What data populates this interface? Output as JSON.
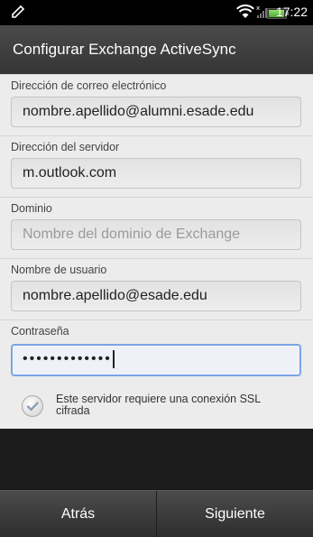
{
  "status_bar": {
    "time": "17:22"
  },
  "header": {
    "title": "Configurar Exchange ActiveSync"
  },
  "form": {
    "email": {
      "label": "Dirección de correo electrónico",
      "value": "nombre.apellido@alumni.esade.edu"
    },
    "server": {
      "label": "Dirección del servidor",
      "value": "m.outlook.com"
    },
    "domain": {
      "label": "Dominio",
      "placeholder": "Nombre del dominio de Exchange"
    },
    "username": {
      "label": "Nombre de usuario",
      "value": "nombre.apellido@esade.edu"
    },
    "password": {
      "label": "Contraseña",
      "value": "•••••••••••••"
    },
    "ssl": {
      "label": "Este servidor requiere una conexión SSL cifrada",
      "checked": true
    }
  },
  "footer": {
    "back_label": "Atrás",
    "next_label": "Siguiente"
  }
}
